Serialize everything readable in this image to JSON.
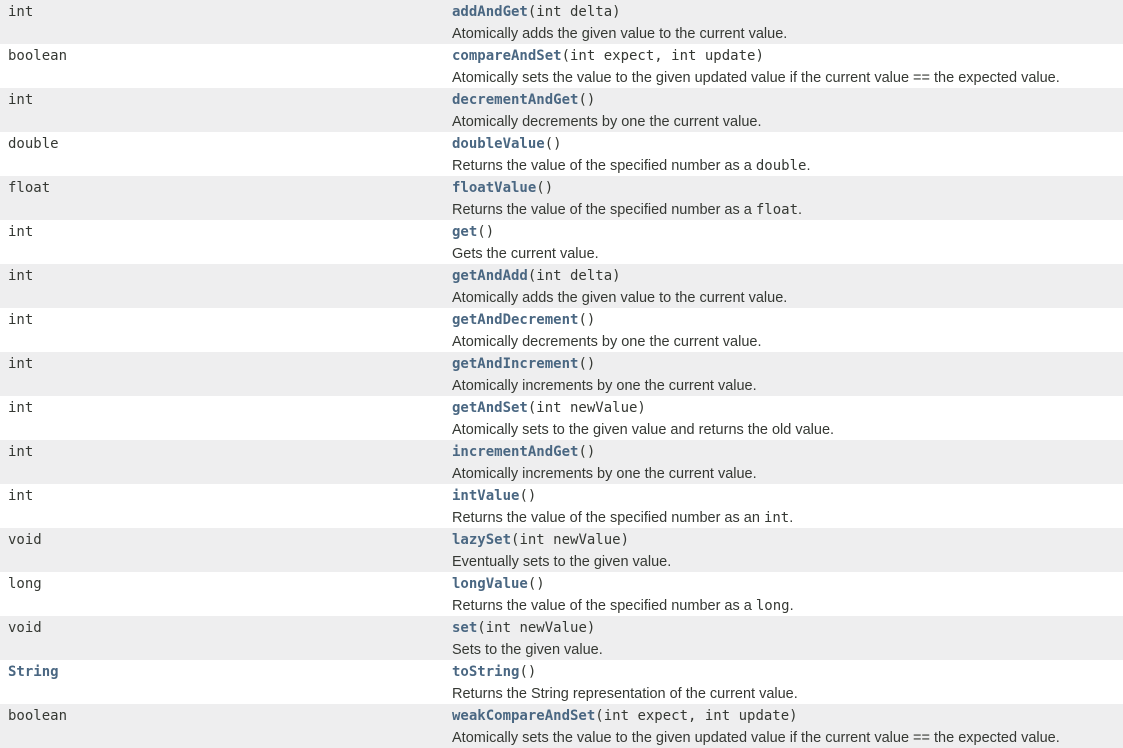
{
  "colors": {
    "link": "#4a6782",
    "text": "#353833",
    "row_alt_background": "#eeeeef",
    "row_background": "#ffffff"
  },
  "methods": [
    {
      "type": "int",
      "type_is_link": false,
      "name": "addAndGet",
      "params": "(int delta)",
      "desc_pre": "Atomically adds the given value to the current value.",
      "desc_code": "",
      "desc_post": ""
    },
    {
      "type": "boolean",
      "type_is_link": false,
      "name": "compareAndSet",
      "params": "(int expect, int update)",
      "desc_pre": "Atomically sets the value to the given updated value if the current value == the expected value.",
      "desc_code": "",
      "desc_post": ""
    },
    {
      "type": "int",
      "type_is_link": false,
      "name": "decrementAndGet",
      "params": "()",
      "desc_pre": "Atomically decrements by one the current value.",
      "desc_code": "",
      "desc_post": ""
    },
    {
      "type": "double",
      "type_is_link": false,
      "name": "doubleValue",
      "params": "()",
      "desc_pre": "Returns the value of the specified number as a ",
      "desc_code": "double",
      "desc_post": "."
    },
    {
      "type": "float",
      "type_is_link": false,
      "name": "floatValue",
      "params": "()",
      "desc_pre": "Returns the value of the specified number as a ",
      "desc_code": "float",
      "desc_post": "."
    },
    {
      "type": "int",
      "type_is_link": false,
      "name": "get",
      "params": "()",
      "desc_pre": "Gets the current value.",
      "desc_code": "",
      "desc_post": ""
    },
    {
      "type": "int",
      "type_is_link": false,
      "name": "getAndAdd",
      "params": "(int delta)",
      "desc_pre": "Atomically adds the given value to the current value.",
      "desc_code": "",
      "desc_post": ""
    },
    {
      "type": "int",
      "type_is_link": false,
      "name": "getAndDecrement",
      "params": "()",
      "desc_pre": "Atomically decrements by one the current value.",
      "desc_code": "",
      "desc_post": ""
    },
    {
      "type": "int",
      "type_is_link": false,
      "name": "getAndIncrement",
      "params": "()",
      "desc_pre": "Atomically increments by one the current value.",
      "desc_code": "",
      "desc_post": ""
    },
    {
      "type": "int",
      "type_is_link": false,
      "name": "getAndSet",
      "params": "(int newValue)",
      "desc_pre": "Atomically sets to the given value and returns the old value.",
      "desc_code": "",
      "desc_post": ""
    },
    {
      "type": "int",
      "type_is_link": false,
      "name": "incrementAndGet",
      "params": "()",
      "desc_pre": "Atomically increments by one the current value.",
      "desc_code": "",
      "desc_post": ""
    },
    {
      "type": "int",
      "type_is_link": false,
      "name": "intValue",
      "params": "()",
      "desc_pre": "Returns the value of the specified number as an ",
      "desc_code": "int",
      "desc_post": "."
    },
    {
      "type": "void",
      "type_is_link": false,
      "name": "lazySet",
      "params": "(int newValue)",
      "desc_pre": "Eventually sets to the given value.",
      "desc_code": "",
      "desc_post": ""
    },
    {
      "type": "long",
      "type_is_link": false,
      "name": "longValue",
      "params": "()",
      "desc_pre": "Returns the value of the specified number as a ",
      "desc_code": "long",
      "desc_post": "."
    },
    {
      "type": "void",
      "type_is_link": false,
      "name": "set",
      "params": "(int newValue)",
      "desc_pre": "Sets to the given value.",
      "desc_code": "",
      "desc_post": ""
    },
    {
      "type": "String",
      "type_is_link": true,
      "name": "toString",
      "params": "()",
      "desc_pre": "Returns the String representation of the current value.",
      "desc_code": "",
      "desc_post": ""
    },
    {
      "type": "boolean",
      "type_is_link": false,
      "name": "weakCompareAndSet",
      "params": "(int expect, int update)",
      "desc_pre": "Atomically sets the value to the given updated value if the current value == the expected value.",
      "desc_code": "",
      "desc_post": ""
    }
  ]
}
